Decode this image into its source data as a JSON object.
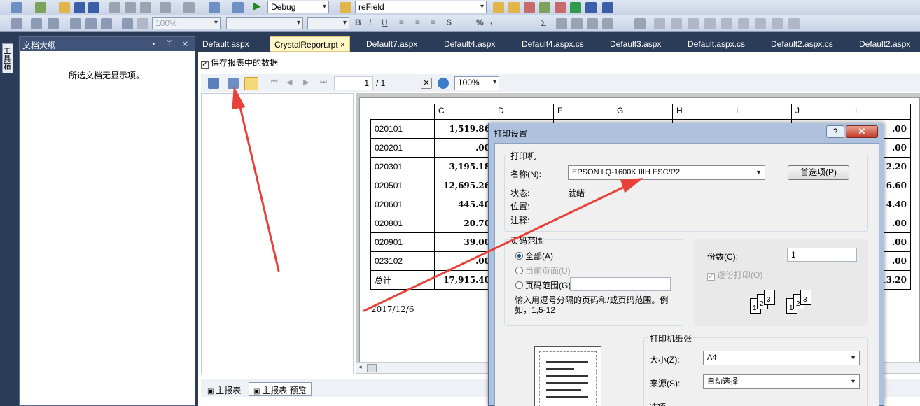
{
  "toolbar": {
    "config_combo": "Debug",
    "find_combo": "reField",
    "zoom_combo": "100%",
    "font_combo": "",
    "size_combo": ""
  },
  "sidebar": {
    "toolbox_label": "工具箱"
  },
  "outline": {
    "title": "文档大纲",
    "buttons": "▾ ᛘ ✕",
    "empty_text": "所选文档无显示项。"
  },
  "tabs": [
    {
      "label": "Default.aspx"
    },
    {
      "label": "CrystalReport.rpt ×"
    },
    {
      "label": "Default7.aspx"
    },
    {
      "label": "Default4.aspx"
    },
    {
      "label": "Default4.aspx.cs"
    },
    {
      "label": "Default3.aspx"
    },
    {
      "label": "Default.aspx.cs"
    },
    {
      "label": "Default2.aspx.cs"
    },
    {
      "label": "Default2.aspx"
    }
  ],
  "doc": {
    "save_data_checkbox": "保存报表中的数据",
    "page_current": "1",
    "page_total": "/ 1",
    "zoom": "100%"
  },
  "report": {
    "headers": [
      "C",
      "D",
      "F",
      "G",
      "H",
      "I",
      "J",
      "L"
    ],
    "rows": [
      {
        "code": "020101",
        "c": "1,519.86",
        "l": ".00"
      },
      {
        "code": "020201",
        "c": ".00",
        "l": ".00"
      },
      {
        "code": "020301",
        "c": "3,195.18",
        "l": "2.20"
      },
      {
        "code": "020501",
        "c": "12,695.26",
        "l": "6.60"
      },
      {
        "code": "020601",
        "c": "445.40",
        "l": "4.40"
      },
      {
        "code": "020801",
        "c": "20.70",
        "l": ".00"
      },
      {
        "code": "020901",
        "c": "39.00",
        "l": ".00"
      },
      {
        "code": "023102",
        "c": ".00",
        "l": ".00"
      },
      {
        "code": "总计",
        "c": "17,915.40",
        "l": "13.20"
      }
    ],
    "date": "2017/12/6"
  },
  "bottom_tabs": [
    "主报表",
    "主报表 预览"
  ],
  "dialog": {
    "title": "打印设置",
    "help": "?",
    "close": "✕",
    "printer_group": "打印机",
    "name_label": "名称(N):",
    "printer_name": "EPSON LQ-1600K IIIH ESC/P2",
    "prefs_button": "首选项(P)",
    "status_label": "状态:",
    "status_value": "就绪",
    "location_label": "位置:",
    "comment_label": "注释:",
    "range_group": "页码范围",
    "range_all": "全部(A)",
    "range_current": "当前页面(U)",
    "range_pages": "页码范围(G)",
    "range_hint": "输入用逗号分隔的页码和/或页码范围。例如，1,5-12",
    "copies_label": "份数(C):",
    "copies_value": "1",
    "collate_label": "逐份打印(O)",
    "paper_group": "打印机纸张",
    "size_label": "大小(Z):",
    "size_value": "A4",
    "source_label": "来源(S):",
    "source_value": "自动选择",
    "options_group": "选项"
  },
  "colors": {
    "arrow": "#e8413a",
    "active_tab": "#fff6c7"
  }
}
